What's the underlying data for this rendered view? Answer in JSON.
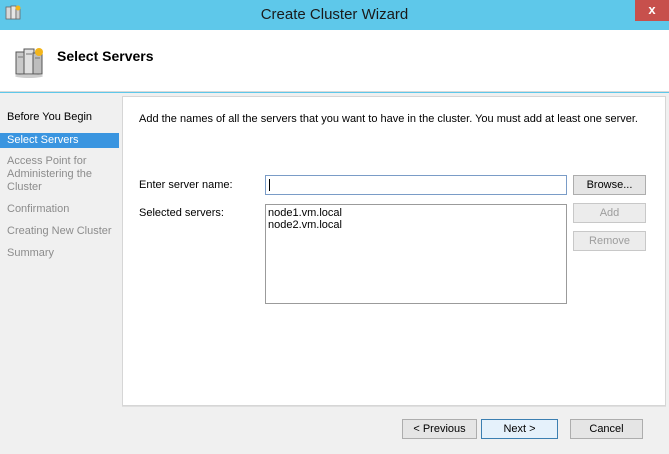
{
  "window": {
    "title": "Create Cluster Wizard",
    "close_glyph": "x",
    "app_icon": "cluster-wizard-icon"
  },
  "header": {
    "title": "Select Servers",
    "icon": "servers-icon"
  },
  "sidebar": {
    "items": [
      {
        "label": "Before You Begin",
        "state": "done"
      },
      {
        "label": "Select Servers",
        "state": "active"
      },
      {
        "label": "Access Point for Administering the Cluster",
        "state": "pending"
      },
      {
        "label": "Confirmation",
        "state": "pending"
      },
      {
        "label": "Creating New Cluster",
        "state": "pending"
      },
      {
        "label": "Summary",
        "state": "pending"
      }
    ]
  },
  "main": {
    "instructions": "Add the names of all the servers that you want to have in the cluster. You must add at least one server.",
    "server_name_label": "Enter server name:",
    "server_name_value": "",
    "browse_label": "Browse...",
    "selected_label": "Selected servers:",
    "selected_servers": [
      "node1.vm.local",
      "node2.vm.local"
    ],
    "add_label": "Add",
    "remove_label": "Remove"
  },
  "footer": {
    "previous_label": "< Previous",
    "next_label": "Next >",
    "cancel_label": "Cancel"
  },
  "colors": {
    "titlebar": "#5ec8ea",
    "close_button": "#c7504c",
    "active_step": "#3a95e0"
  }
}
